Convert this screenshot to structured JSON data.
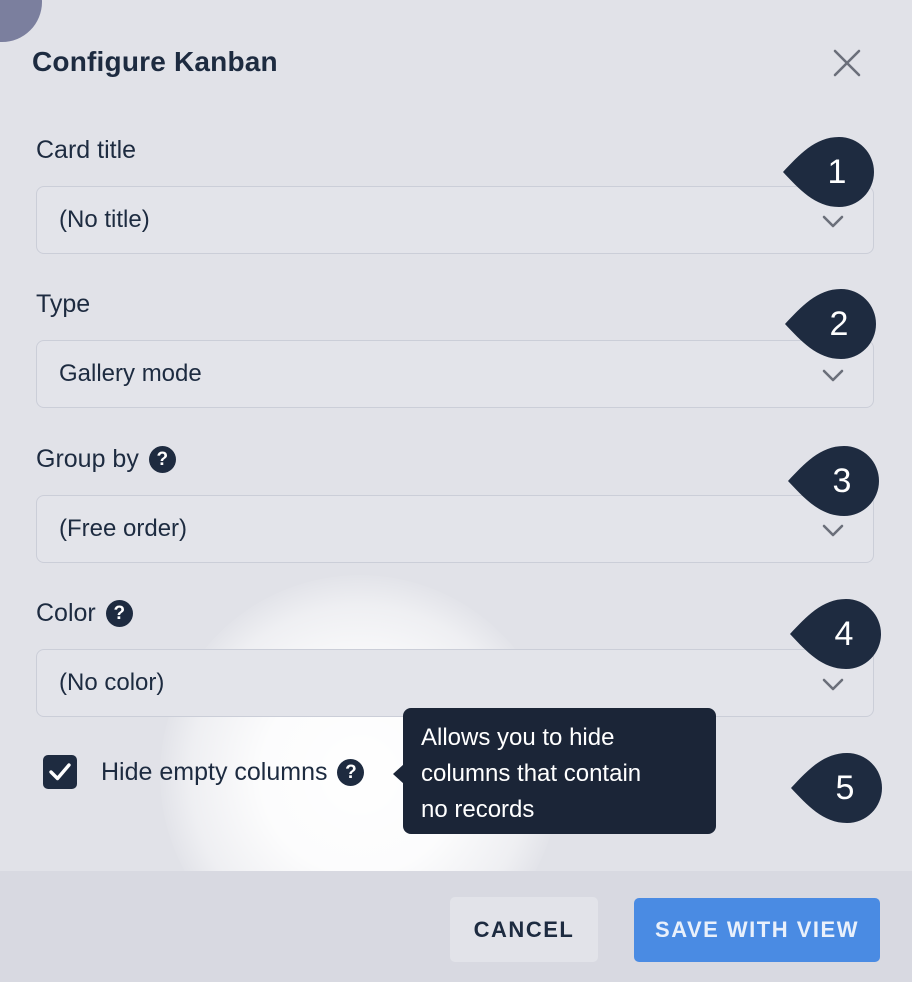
{
  "dialog": {
    "title": "Configure Kanban"
  },
  "fields": {
    "card_title": {
      "label": "Card title",
      "value": "(No title)",
      "badge": "1"
    },
    "type": {
      "label": "Type",
      "value": "Gallery mode",
      "badge": "2"
    },
    "group_by": {
      "label": "Group by",
      "value": "(Free order)",
      "badge": "3",
      "help_glyph": "?"
    },
    "color": {
      "label": "Color",
      "value": "(No color)",
      "badge": "4",
      "help_glyph": "?"
    }
  },
  "hide_empty": {
    "label": "Hide empty columns",
    "checked": true,
    "help_glyph": "?",
    "badge": "5",
    "tooltip_lines": [
      "Allows you to hide",
      "columns that contain",
      "no records"
    ]
  },
  "footer": {
    "cancel_label": "CANCEL",
    "save_label": "SAVE WITH VIEW"
  },
  "icons": {
    "close": "close-icon",
    "chevron": "chevron-down-icon",
    "check": "check-icon",
    "help": "help-icon"
  },
  "colors": {
    "primary_dark": "#1e2b40",
    "accent_blue": "#4a8be3",
    "background": "#e1e2e8",
    "footer_bg": "#d8d9e1"
  }
}
